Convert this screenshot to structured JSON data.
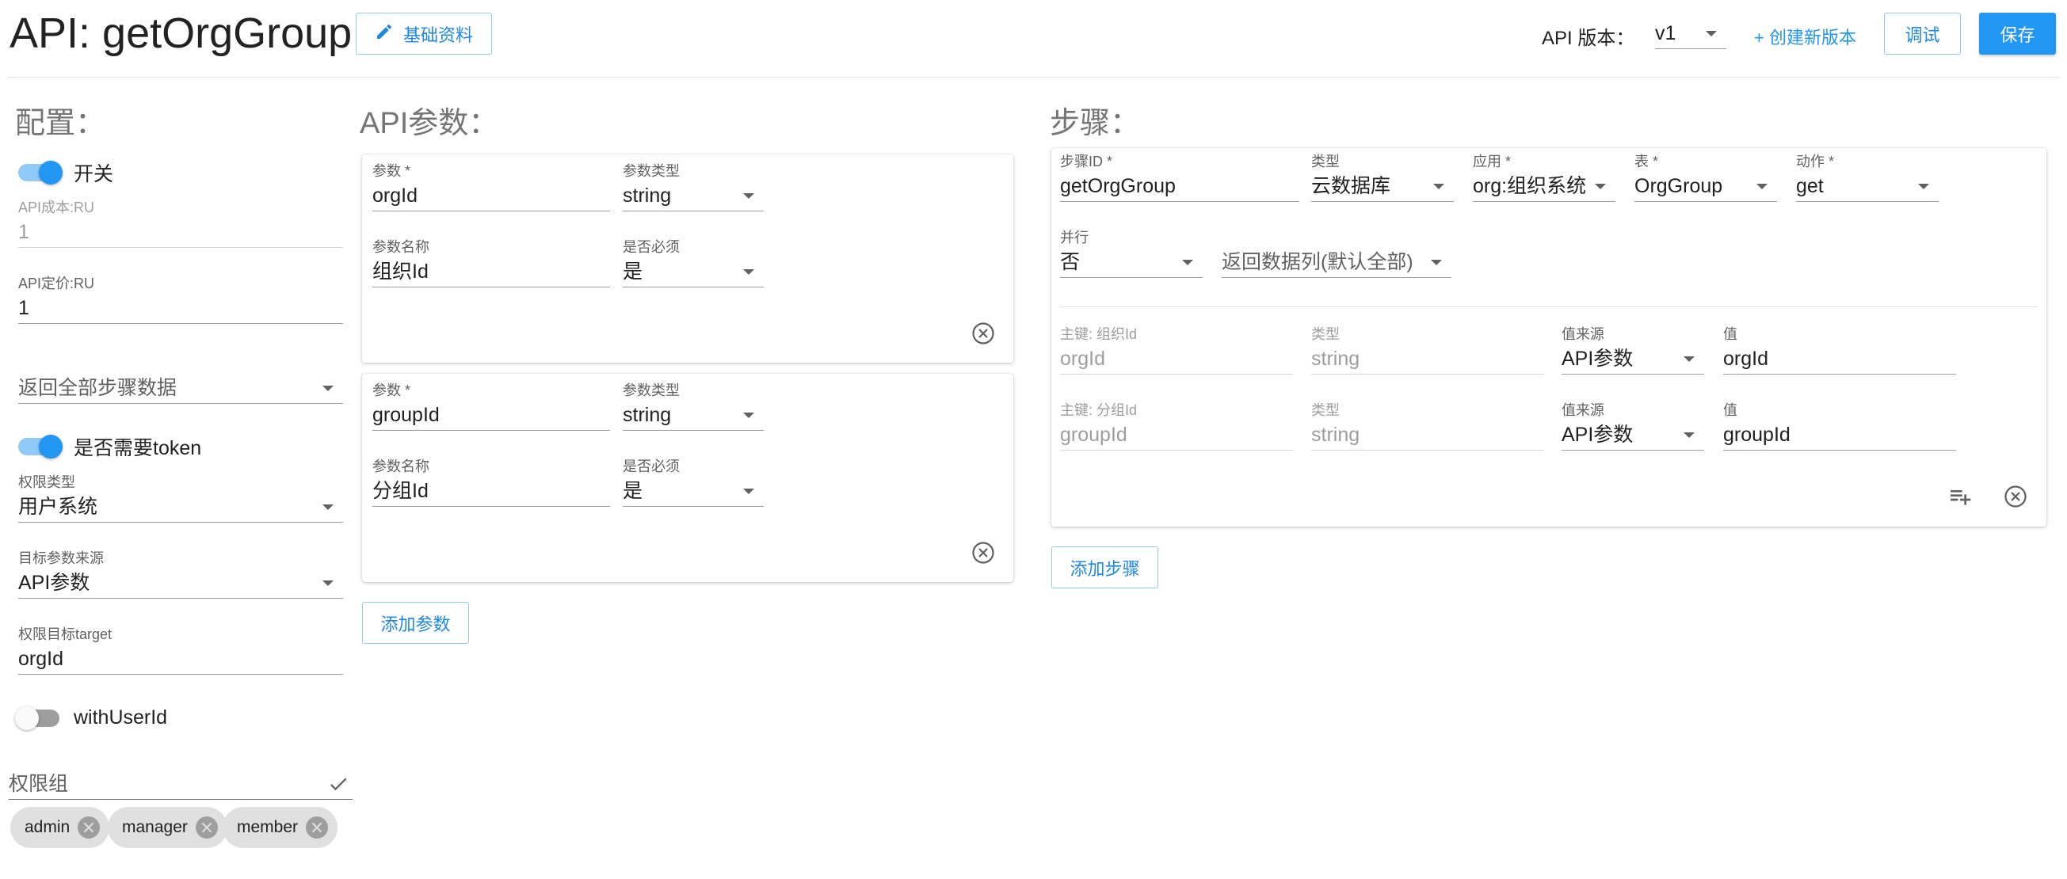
{
  "header": {
    "title": "API: getOrgGroup",
    "basic_info_label": "基础资料",
    "version_label": "API 版本：",
    "version_value": "v1",
    "create_version_label": "+ 创建新版本",
    "debug_label": "调试",
    "save_label": "保存",
    "accent_color": "#2196f3"
  },
  "config": {
    "title": "配置：",
    "switch_label": "开关",
    "switch_on": true,
    "api_cost_label": "API成本:RU",
    "api_cost_value": "1",
    "api_price_label": "API定价:RU",
    "api_price_value": "1",
    "return_mode_value": "返回全部步骤数据",
    "need_token_label": "是否需要token",
    "need_token_on": true,
    "perm_type_label": "权限类型",
    "perm_type_value": "用户系统",
    "target_source_label": "目标参数来源",
    "target_source_value": "API参数",
    "perm_target_label": "权限目标target",
    "perm_target_value": "orgId",
    "with_user_id_label": "withUserId",
    "with_user_id_on": false,
    "perm_group_label": "权限组",
    "perm_groups": [
      "admin",
      "manager",
      "member"
    ]
  },
  "params": {
    "title": "API参数：",
    "param_label": "参数 *",
    "type_label": "参数类型",
    "name_label": "参数名称",
    "required_label": "是否必须",
    "items": [
      {
        "param": "orgId",
        "type": "string",
        "name": "组织Id",
        "required": "是"
      },
      {
        "param": "groupId",
        "type": "string",
        "name": "分组Id",
        "required": "是"
      }
    ],
    "add_label": "添加参数"
  },
  "steps": {
    "title": "步骤：",
    "step_id_label": "步骤ID *",
    "step_id_value": "getOrgGroup",
    "type_label": "类型",
    "type_value": "云数据库",
    "app_label": "应用 *",
    "app_value": "org:组织系统",
    "table_label": "表 *",
    "table_value": "OrgGroup",
    "action_label": "动作 *",
    "action_value": "get",
    "parallel_label": "并行",
    "parallel_value": "否",
    "return_cols_value": "返回数据列(默认全部)",
    "keys": [
      {
        "key_label": "主键: 组织Id",
        "key_value": "orgId",
        "type_label": "类型",
        "type_value": "string",
        "source_label": "值来源",
        "source_value": "API参数",
        "value_label": "值",
        "value": "orgId"
      },
      {
        "key_label": "主键: 分组Id",
        "key_value": "groupId",
        "type_label": "类型",
        "type_value": "string",
        "source_label": "值来源",
        "source_value": "API参数",
        "value_label": "值",
        "value": "groupId"
      }
    ],
    "add_label": "添加步骤"
  }
}
